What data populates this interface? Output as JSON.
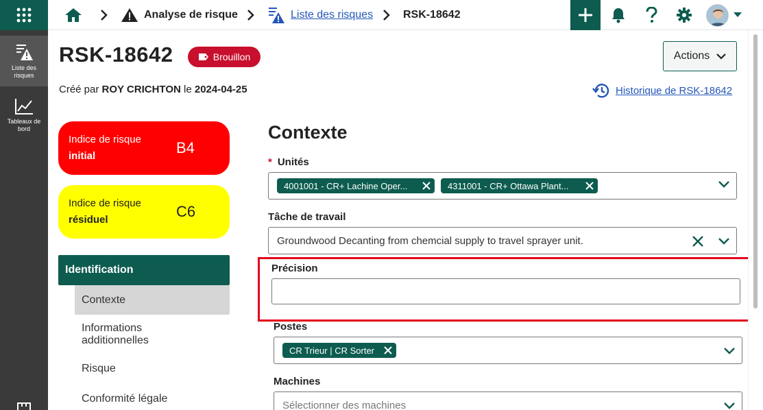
{
  "rail": {
    "items": [
      {
        "label": "Liste des risques",
        "icon": "list-warning-icon",
        "active": true
      },
      {
        "label": "Tableaux de bord",
        "icon": "line-chart-icon",
        "active": false
      }
    ]
  },
  "topbar": {
    "breadcrumb": {
      "home_icon": "home-icon",
      "section": "Analyse de risque",
      "list_link": "Liste des risques",
      "current": "RSK-18642"
    },
    "icons": [
      "plus-icon",
      "bell-icon",
      "help-icon",
      "gear-icon",
      "avatar",
      "chevron-down-icon"
    ]
  },
  "header": {
    "title": "RSK-18642",
    "status": "Brouillon",
    "actions_label": "Actions",
    "created_prefix": "Créé par",
    "created_by": "ROY CRICHTON",
    "created_mid": "le",
    "created_date": "2024-04-25",
    "history_link": "Historique de RSK-18642"
  },
  "risk": {
    "initial": {
      "line1": "Indice de risque",
      "line2": "initial",
      "value": "B4",
      "color": "#ff0000"
    },
    "residual": {
      "line1": "Indice de risque",
      "line2": "résiduel",
      "value": "C6",
      "color": "#ffff00"
    }
  },
  "nav": {
    "group": "Identification",
    "items": [
      "Contexte",
      "Informations additionnelles",
      "Risque",
      "Conformité légale"
    ],
    "active": "Contexte"
  },
  "form": {
    "section_title": "Contexte",
    "units": {
      "required_mark": "*",
      "label": "Unités",
      "chips": [
        "4001001 - CR+ Lachine Oper...",
        "4311001 - CR+ Ottawa Plant..."
      ]
    },
    "task": {
      "label": "Tâche de travail",
      "value": "Groundwood Decanting from chemcial supply to travel sprayer unit."
    },
    "precision": {
      "label": "Précision",
      "value": ""
    },
    "postes": {
      "label": "Postes",
      "chips": [
        "CR Trieur | CR Sorter"
      ]
    },
    "machines": {
      "label": "Machines",
      "placeholder": "Sélectionner des machines"
    }
  },
  "colors": {
    "brand": "#0d5c4f",
    "draft_badge": "#c8102e",
    "link": "#2456b8",
    "highlight": "#e3001b"
  }
}
